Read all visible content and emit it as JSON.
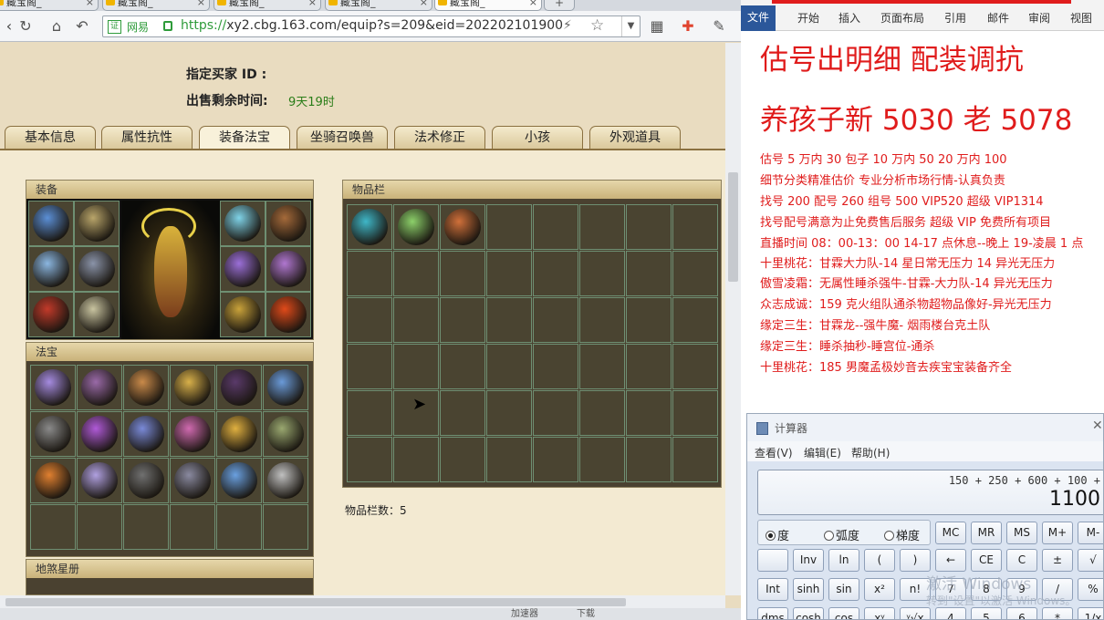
{
  "browser": {
    "tabs": [
      "藏宝阁_",
      "藏宝阁_",
      "藏宝阁_",
      "藏宝阁_",
      "藏宝阁_"
    ],
    "new_tab_label": "+",
    "site_name": "网易",
    "cert_label": "证",
    "url_host": "https://",
    "url_rest": "xy2.cbg.163.com/equip?s=209&eid=20220210190021",
    "nav_icons": [
      "refresh-icon",
      "home-icon",
      "back-icon"
    ],
    "status_items": [
      "加速器",
      "下载"
    ]
  },
  "page": {
    "designated_buyer_label": "指定买家 ID :",
    "time_left_label": "出售剩余时间:",
    "time_left_value": "9天19时",
    "tabs": [
      "基本信息",
      "属性抗性",
      "装备法宝",
      "坐骑召唤兽",
      "法术修正",
      "小孩",
      "外观道具"
    ],
    "active_tab_index": 2,
    "panels": {
      "equipment": "装备",
      "fabao": "法宝",
      "inventory": "物品栏",
      "dishastar": "地煞星册"
    },
    "inventory_count_label": "物品栏数：5"
  },
  "word": {
    "file_tab": "文件",
    "ribbon_tabs": [
      "开始",
      "插入",
      "页面布局",
      "引用",
      "邮件",
      "审阅",
      "视图"
    ],
    "lines": [
      "估号出明细 配装调抗",
      "养孩子新 5030 老 5078",
      "估号 5 万内 30 包子  10 万内 50  20 万内 100",
      "细节分类精准估价  专业分析市场行情-认真负责",
      "找号 200   配号 260   组号 500 VIP520   超级 VIP1314",
      "找号配号满意为止免费售后服务  超级 VIP 免费所有项目",
      "直播时间 08：00-13：00  14-17 点休息--晚上 19-凌晨 1 点",
      "十里桃花：甘霖大力队-14 星日常无压力 14 异光无压力",
      "傲雪凌霜：无属性睡杀强牛-甘霖-大力队-14 异光无压力",
      "众志成诚：159 克火组队通杀物超物品像好-异光无压力",
      "缘定三生：甘霖龙--强牛魔-     烟雨楼台克土队",
      "缘定三生：睡杀抽秒-睡宫位-通杀",
      "十里桃花：185 男魔孟极妙音去疾宝宝装备齐全"
    ]
  },
  "calc": {
    "title": "计算器",
    "menu": [
      "查看(V)",
      "编辑(E)",
      "帮助(H)"
    ],
    "expression": "150 + 250 + 600 + 100 +",
    "result": "1100",
    "modes": [
      "度",
      "弧度",
      "梯度"
    ],
    "mode_selected": 0,
    "row1": [
      "MC",
      "MR",
      "MS",
      "M+",
      "M-"
    ],
    "row2": [
      "",
      "Inv",
      "ln",
      "(",
      ")",
      "←",
      "CE",
      "C",
      "±",
      "√"
    ],
    "row3": [
      "Int",
      "sinh",
      "sin",
      "x²",
      "n!",
      "7",
      "8",
      "9",
      "/",
      "%"
    ],
    "row4": [
      "dms",
      "cosh",
      "cos",
      "xʸ",
      "ʸ√x",
      "4",
      "5",
      "6",
      "*",
      "1/x"
    ],
    "watermark": "激活 Windows",
    "watermark_sub": "转到\"设置\"以激活 Windows。"
  }
}
